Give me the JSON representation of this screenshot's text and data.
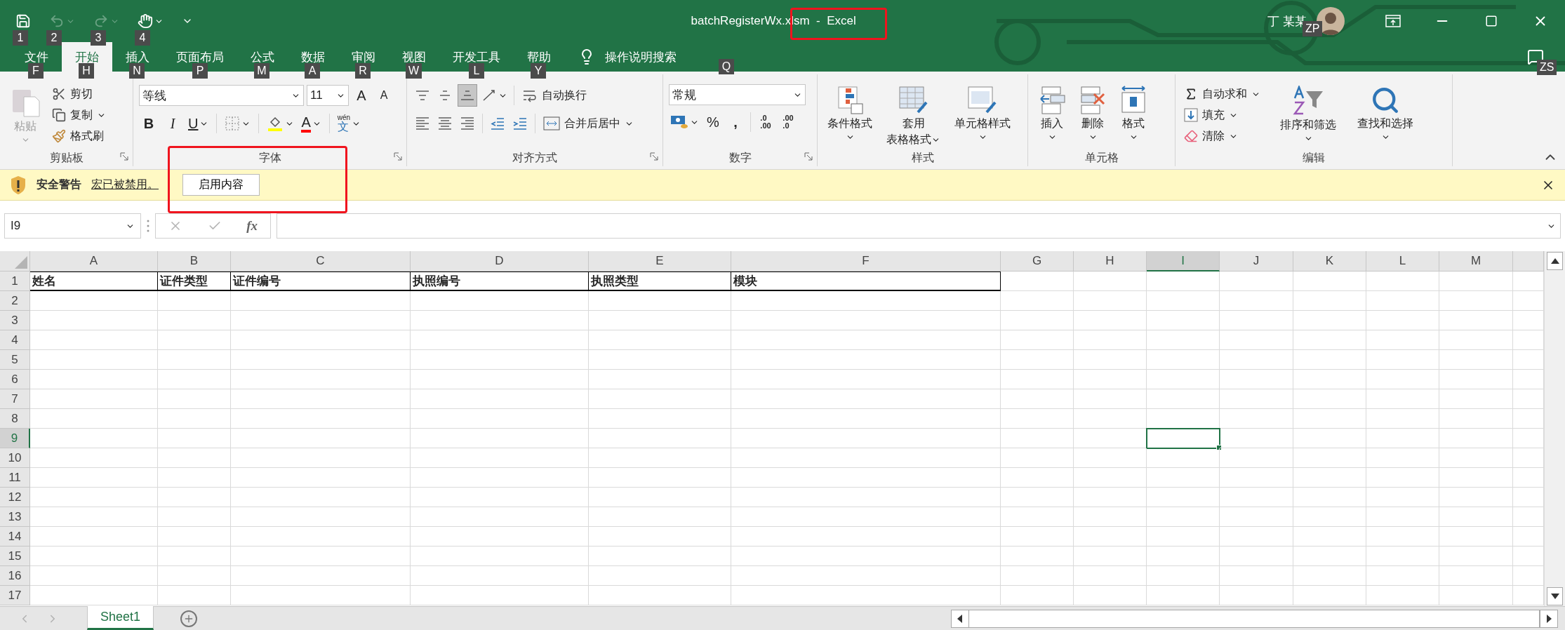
{
  "title_bar": {
    "title": "batchRegisterWx.xlsm  -  Excel",
    "user": "丁 某某",
    "quick_access_keytips": [
      "1",
      "2",
      "3",
      "4"
    ],
    "user_keytip": "ZP"
  },
  "tabs": [
    {
      "label": "文件",
      "keytip": "F",
      "selected": false
    },
    {
      "label": "开始",
      "keytip": "H",
      "selected": true
    },
    {
      "label": "插入",
      "keytip": "N",
      "selected": false
    },
    {
      "label": "页面布局",
      "keytip": "P",
      "selected": false
    },
    {
      "label": "公式",
      "keytip": "M",
      "selected": false
    },
    {
      "label": "数据",
      "keytip": "A",
      "selected": false
    },
    {
      "label": "审阅",
      "keytip": "R",
      "selected": false
    },
    {
      "label": "视图",
      "keytip": "W",
      "selected": false
    },
    {
      "label": "开发工具",
      "keytip": "L",
      "selected": false
    },
    {
      "label": "帮助",
      "keytip": "Y",
      "selected": false
    }
  ],
  "tell_me": {
    "label": "操作说明搜索",
    "keytip": "Q"
  },
  "comments_keytip": "ZS",
  "ribbon": {
    "clipboard": {
      "label": "剪贴板",
      "paste": "粘贴",
      "cut": "剪切",
      "copy": "复制",
      "format_painter": "格式刷"
    },
    "font": {
      "label": "字体",
      "font_name": "等线",
      "font_size": "11",
      "grow": "A",
      "shrink": "A",
      "bold": "B",
      "italic": "I",
      "underline": "U",
      "font_color": "A",
      "phonetic_reading": "wén",
      "phonetic_char": "文"
    },
    "alignment": {
      "label": "对齐方式",
      "wrap_text": "自动换行",
      "merge_center": "合并后居中",
      "vertical_align": [
        {
          "kind": "top",
          "selected": false
        },
        {
          "kind": "middle",
          "selected": false
        },
        {
          "kind": "bottom",
          "selected": true
        }
      ]
    },
    "number": {
      "label": "数字",
      "format": "常规",
      "percent": "%",
      "comma": ",",
      "increase_decimal": [
        ".0",
        ".00"
      ],
      "decrease_decimal": [
        ".00",
        ".0"
      ]
    },
    "styles": {
      "label": "样式",
      "conditional": "条件格式",
      "format_table": [
        "套用",
        "表格格式"
      ],
      "cell_styles": "单元格样式"
    },
    "cells": {
      "label": "单元格",
      "insert": "插入",
      "delete": "删除",
      "format": "格式"
    },
    "editing": {
      "label": "编辑",
      "autosum": "自动求和",
      "fill": "填充",
      "clear": "清除",
      "sort_filter": "排序和筛选",
      "find_select": "查找和选择"
    }
  },
  "security_bar": {
    "title": "安全警告",
    "message": "宏已被禁用。",
    "button": "启用内容"
  },
  "formula_bar": {
    "name_box": "I9",
    "function_label": "fx"
  },
  "sheet": {
    "columns": [
      {
        "label": "A",
        "selected": false
      },
      {
        "label": "B",
        "selected": false
      },
      {
        "label": "C",
        "selected": false
      },
      {
        "label": "D",
        "selected": false
      },
      {
        "label": "E",
        "selected": false
      },
      {
        "label": "F",
        "selected": false
      },
      {
        "label": "G",
        "selected": false
      },
      {
        "label": "H",
        "selected": false
      },
      {
        "label": "I",
        "selected": true
      },
      {
        "label": "J",
        "selected": false
      },
      {
        "label": "K",
        "selected": false
      },
      {
        "label": "L",
        "selected": false
      },
      {
        "label": "M",
        "selected": false
      }
    ],
    "rows": [
      {
        "label": "1",
        "selected": false,
        "cells": [
          "姓名",
          "证件类型",
          "证件编号",
          "执照编号",
          "执照类型",
          "模块"
        ]
      },
      {
        "label": "2",
        "selected": false
      },
      {
        "label": "3",
        "selected": false
      },
      {
        "label": "4",
        "selected": false
      },
      {
        "label": "5",
        "selected": false
      },
      {
        "label": "6",
        "selected": false
      },
      {
        "label": "7",
        "selected": false
      },
      {
        "label": "8",
        "selected": false
      },
      {
        "label": "9",
        "selected": true
      },
      {
        "label": "10",
        "selected": false
      },
      {
        "label": "11",
        "selected": false
      },
      {
        "label": "12",
        "selected": false
      },
      {
        "label": "13",
        "selected": false
      },
      {
        "label": "14",
        "selected": false
      },
      {
        "label": "15",
        "selected": false
      },
      {
        "label": "16",
        "selected": false
      },
      {
        "label": "17",
        "selected": false
      }
    ]
  },
  "sheet_tabs": [
    {
      "label": "Sheet1",
      "selected": true
    }
  ]
}
